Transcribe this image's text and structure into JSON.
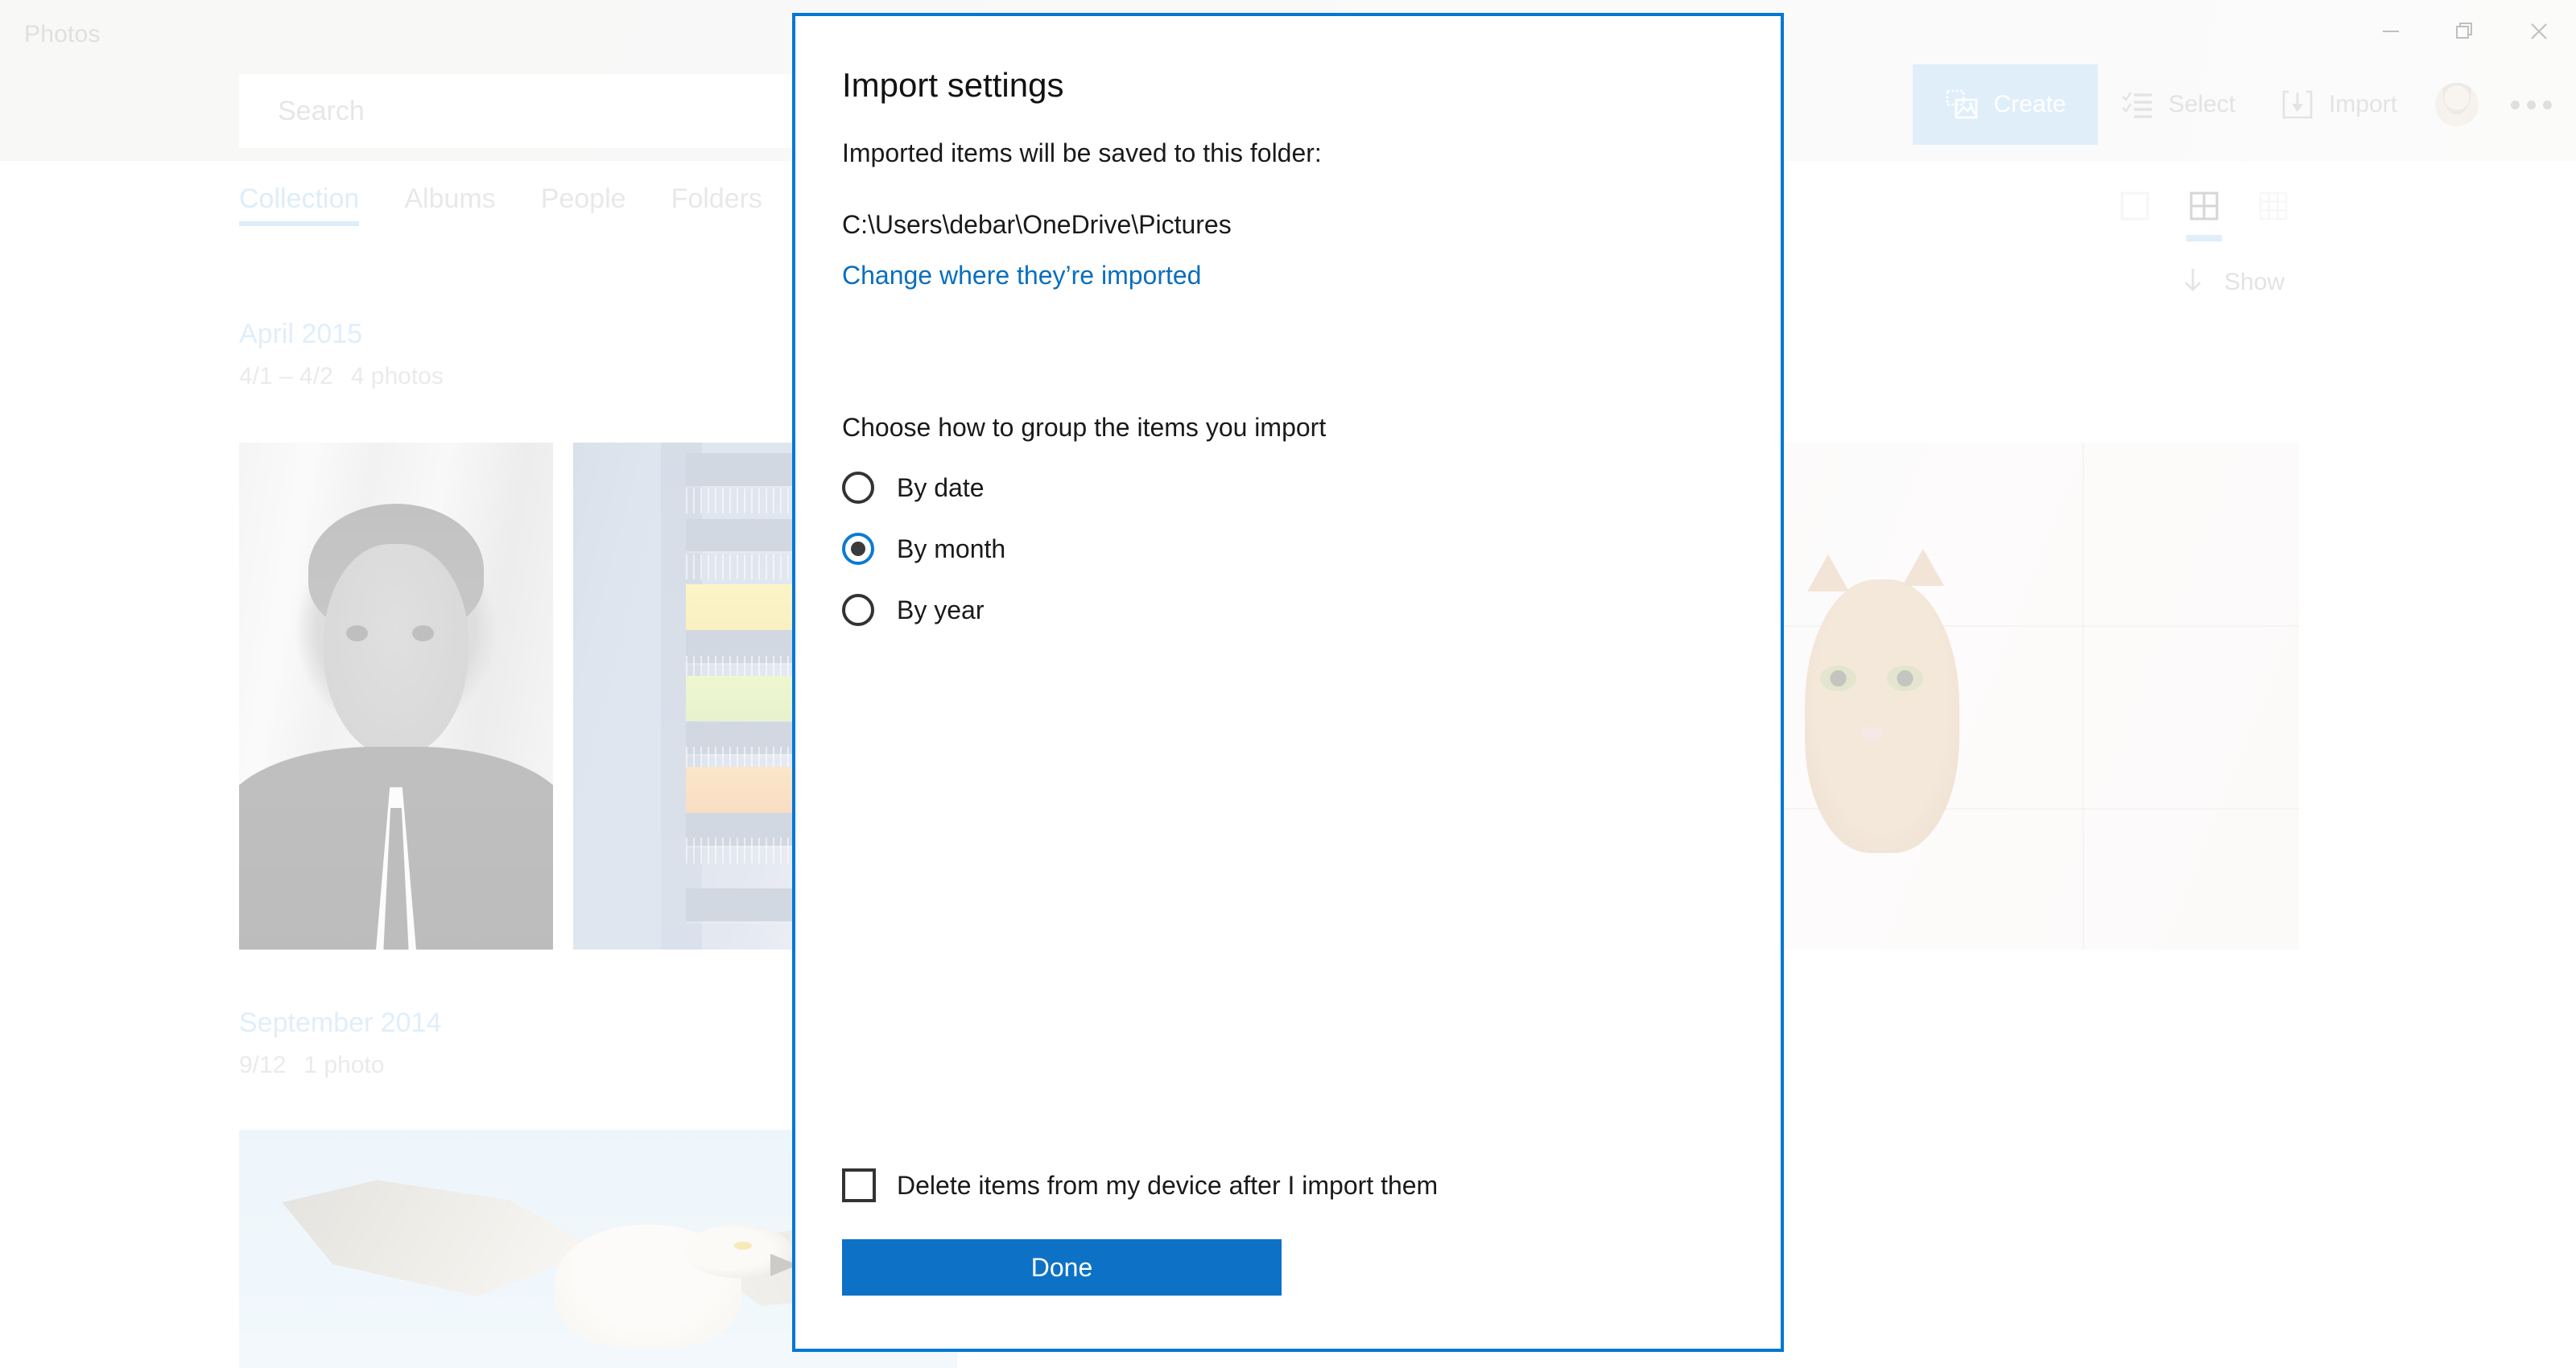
{
  "window": {
    "app_title": "Photos",
    "controls": [
      {
        "name": "minimize",
        "glyph": "minimize-icon"
      },
      {
        "name": "maximize",
        "glyph": "restore-icon"
      },
      {
        "name": "close",
        "glyph": "close-icon"
      }
    ]
  },
  "search": {
    "placeholder": "Search"
  },
  "commandbar": {
    "create_label": "Create",
    "select_label": "Select",
    "import_label": "Import",
    "create_icon": "create-photo-video-icon",
    "select_icon": "checklist-icon",
    "import_icon": "import-download-icon",
    "avatar": "account-avatar",
    "more_icon": "more-ellipsis-icon"
  },
  "tabs": [
    {
      "label": "Collection",
      "active": true
    },
    {
      "label": "Albums",
      "active": false
    },
    {
      "label": "People",
      "active": false
    },
    {
      "label": "Folders",
      "active": false
    }
  ],
  "viewmodes": [
    {
      "name": "single-tile-view",
      "active": false
    },
    {
      "name": "medium-grid-view",
      "active": true
    },
    {
      "name": "small-grid-view",
      "active": false
    }
  ],
  "show_control": {
    "label": "Show",
    "icon": "arrow-down-icon"
  },
  "groups": [
    {
      "title": "April 2015",
      "date_range": "4/1 – 4/2",
      "count": "4 photos",
      "photos": [
        {
          "name": "photo-bw-portrait",
          "alt": "black and white portrait of a man in a suit"
        },
        {
          "name": "photo-colorful-balconies",
          "alt": "apartment building with colorful balconies"
        },
        {
          "name": "photo-cat-tiles",
          "alt": "tabby cat peeking over white tiles"
        }
      ]
    },
    {
      "title": "September 2014",
      "date_range": "9/12",
      "count": "1 photo",
      "photos": [
        {
          "name": "photo-osprey-flight",
          "alt": "osprey bird in flight against blue sky"
        }
      ]
    }
  ],
  "dialog": {
    "title": "Import settings",
    "folder_prompt": "Imported items will be saved to this folder:",
    "folder_path": "C:\\Users\\debar\\OneDrive\\Pictures",
    "change_link": "Change where they’re imported",
    "group_prompt": "Choose how to group the items you import",
    "options": [
      {
        "label": "By date",
        "checked": false
      },
      {
        "label": "By month",
        "checked": true
      },
      {
        "label": "By year",
        "checked": false
      }
    ],
    "delete_checkbox_label": "Delete items from my device after I import them",
    "delete_checkbox_checked": false,
    "done_label": "Done"
  },
  "colors": {
    "accent_blue": "#0078d4",
    "button_blue": "#0d72c6",
    "link_blue": "#0a6ebd",
    "tab_active": "#86bdea",
    "create_bg": "#8fc2ee",
    "chrome_bg": "#e9e9e6"
  }
}
